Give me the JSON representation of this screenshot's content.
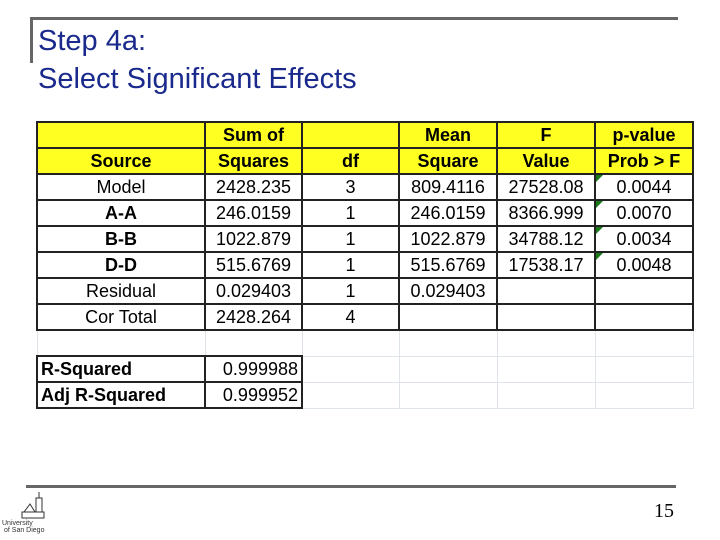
{
  "slide": {
    "title_line1": "Step 4a:",
    "title_line2": "Select Significant Effects",
    "page_number": "15"
  },
  "logo": {
    "text": "University of San Diego"
  },
  "colors": {
    "header_fill": "#ffff22",
    "title": "#1a2a8c",
    "flag": "#1a7a1a"
  },
  "anova": {
    "header1": [
      "",
      "Sum of",
      "",
      "Mean",
      "F",
      "p-value"
    ],
    "header2": [
      "Source",
      "Squares",
      "df",
      "Square",
      "Value",
      "Prob > F"
    ],
    "rows": [
      [
        "Model",
        "2428.235",
        "3",
        "809.4116",
        "27528.08",
        "0.0044"
      ],
      [
        "A-A",
        "246.0159",
        "1",
        "246.0159",
        "8366.999",
        "0.0070"
      ],
      [
        "B-B",
        "1022.879",
        "1",
        "1022.879",
        "34788.12",
        "0.0034"
      ],
      [
        "D-D",
        "515.6769",
        "1",
        "515.6769",
        "17538.17",
        "0.0048"
      ],
      [
        "Residual",
        "0.029403",
        "1",
        "0.029403",
        "",
        ""
      ],
      [
        "Cor Total",
        "2428.264",
        "4",
        "",
        "",
        ""
      ]
    ]
  },
  "fit": [
    {
      "label": "R-Squared",
      "value": "0.999988"
    },
    {
      "label": "Adj R-Squared",
      "value": "0.999952"
    }
  ]
}
